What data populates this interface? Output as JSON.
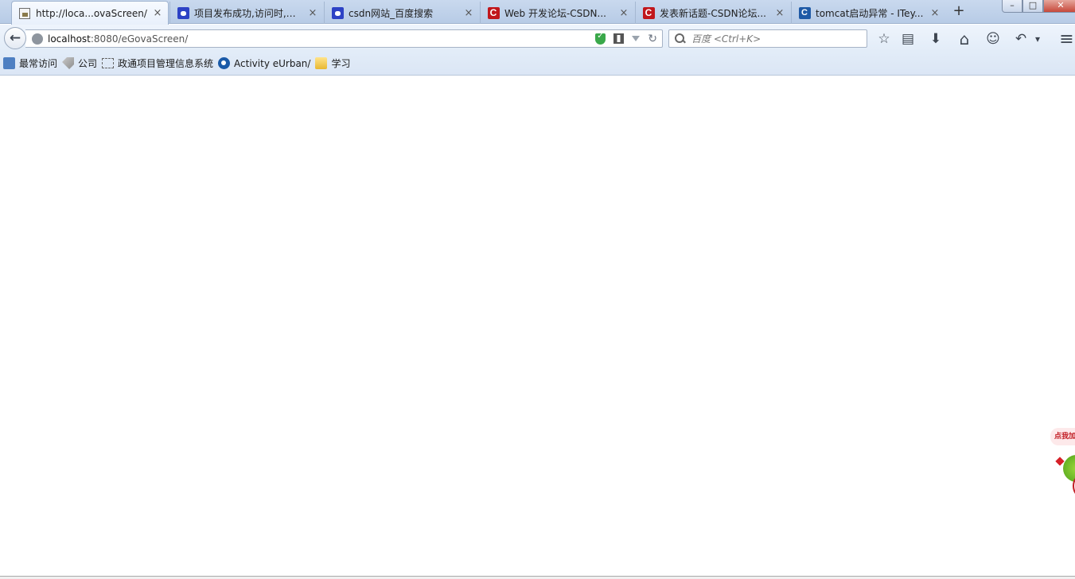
{
  "tabs": [
    {
      "title": "http://loca...ovaScreen/",
      "favicon": "page-icon",
      "active": true
    },
    {
      "title": "项目发布成功,访问时,网...",
      "favicon": "baidu-paw-icon",
      "active": false
    },
    {
      "title": "csdn网站_百度搜索",
      "favicon": "baidu-paw-icon",
      "active": false
    },
    {
      "title": "Web 开发论坛-CSDN...",
      "favicon": "csdn-icon",
      "active": false
    },
    {
      "title": "发表新话题-CSDN论坛...",
      "favicon": "csdn-icon",
      "active": false
    },
    {
      "title": "tomcat启动异常 - ITey...",
      "favicon": "iteye-icon",
      "active": false
    }
  ],
  "tab_close_glyph": "×",
  "new_tab_glyph": "+",
  "window_controls": {
    "min": "–",
    "max": "□",
    "close": "✕"
  },
  "address": {
    "host": "localhost",
    "rest": ":8080/eGovaScreen/"
  },
  "search": {
    "placeholder": "百度 <Ctrl+K>"
  },
  "toolbar_glyphs": {
    "back": "←",
    "reload": "↻",
    "bookmark": "☆",
    "reading_list": "▤",
    "download": "⬇",
    "home": "⌂",
    "chat": "☺",
    "undo": "↶",
    "dropdown": "▾",
    "menu": "≡"
  },
  "bookmarks": [
    {
      "label": "最常访问",
      "icon": "recent-icon"
    },
    {
      "label": "公司",
      "icon": "tag-icon"
    },
    {
      "label": "政通项目管理信息系统",
      "icon": "page-icon"
    },
    {
      "label": "Activity eUrban/",
      "icon": "activity-icon"
    },
    {
      "label": "学习",
      "icon": "folder-icon"
    }
  ],
  "widget": {
    "bubble_text": "点我加"
  },
  "colors": {
    "csdn_red": "#c1171c",
    "baidu_blue": "#2d42c5",
    "shield_green": "#3aa84a"
  }
}
